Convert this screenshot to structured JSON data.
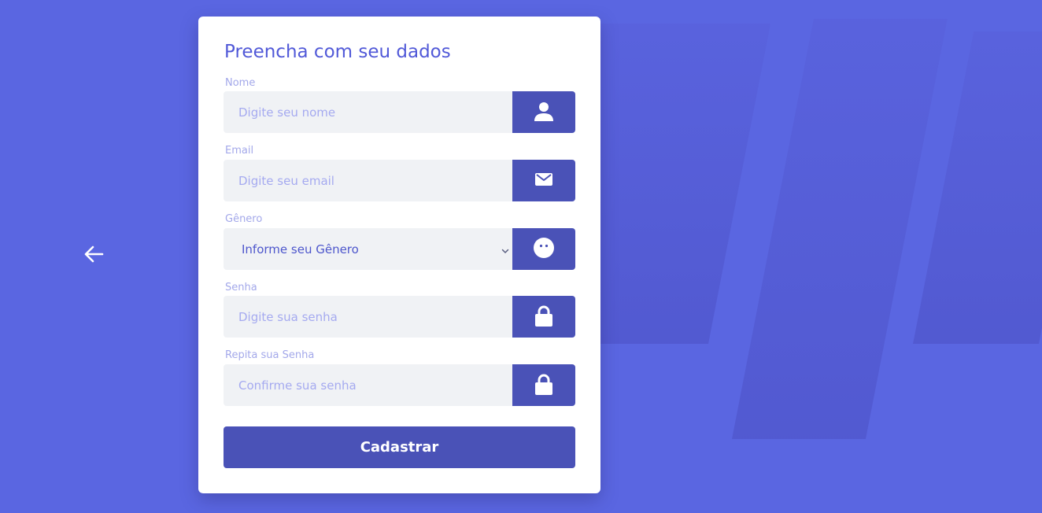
{
  "form": {
    "title": "Preencha com seu dados",
    "fields": [
      {
        "label": "Nome",
        "placeholder": "Digite seu nome",
        "icon": "user-icon"
      },
      {
        "label": "Email",
        "placeholder": "Digite seu email",
        "icon": "mail-icon"
      },
      {
        "label": "Gênero",
        "selected": "Informe seu Gênero",
        "icon": "face-icon"
      },
      {
        "label": "Senha",
        "placeholder": "Digite sua senha",
        "icon": "lock-icon"
      },
      {
        "label": "Repita sua Senha",
        "placeholder": "Confirme sua senha",
        "icon": "lock-icon"
      }
    ],
    "submit_label": "Cadastrar"
  },
  "colors": {
    "background": "#5a66e1",
    "accent": "#4a52b7",
    "title": "#5159d8",
    "label": "#a3a8ea"
  }
}
